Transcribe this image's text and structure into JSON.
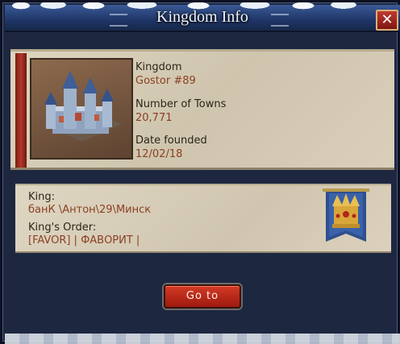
{
  "window": {
    "title": "Kingdom Info"
  },
  "icons": {
    "close": "close-x-icon",
    "castle": "castle-image",
    "crown_banner": "crown-banner-icon"
  },
  "colors": {
    "accent_red": "#b3382a",
    "value_text": "#8a3f22",
    "title_bg": "#1f3566"
  },
  "kingdom": {
    "label": "Kingdom",
    "value": "Gostor #89",
    "towns_label": "Number of Towns",
    "towns_value": "20,771",
    "founded_label": "Date founded",
    "founded_value": "12/02/18"
  },
  "king": {
    "label": "King:",
    "name": "банК \\Антон\\29\\Минск",
    "order_label": "King's Order:",
    "order_value": "[FAVOR] | ФАВОРИТ |"
  },
  "actions": {
    "goto_label": "Go to",
    "close_label": "✕"
  }
}
